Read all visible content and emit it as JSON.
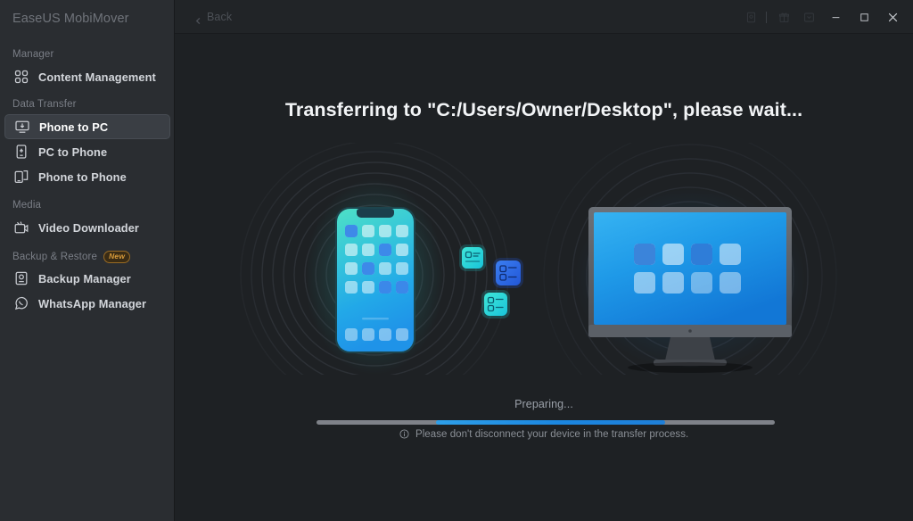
{
  "app": {
    "brand": "EaseUS MobiMover"
  },
  "titlebar": {
    "back_label": "Back",
    "icons": [
      {
        "name": "device-icon",
        "glyph": "device"
      },
      {
        "name": "gift-icon",
        "glyph": "gift"
      },
      {
        "name": "feedback-icon",
        "glyph": "feedback"
      }
    ],
    "minimize_label": "—",
    "maximize_label": "□",
    "close_label": "✕"
  },
  "sidebar": {
    "groups": [
      {
        "label": "Manager",
        "badge": null,
        "items": [
          {
            "label": "Content Management",
            "icon": "grid-apps-icon",
            "active": false
          }
        ]
      },
      {
        "label": "Data Transfer",
        "badge": null,
        "items": [
          {
            "label": "Phone to PC",
            "icon": "phone-to-pc-icon",
            "active": true
          },
          {
            "label": "PC to Phone",
            "icon": "pc-to-phone-icon",
            "active": false
          },
          {
            "label": "Phone to Phone",
            "icon": "phone-to-phone-icon",
            "active": false
          }
        ]
      },
      {
        "label": "Media",
        "badge": null,
        "items": [
          {
            "label": "Video Downloader",
            "icon": "video-download-icon",
            "active": false
          }
        ]
      },
      {
        "label": "Backup & Restore",
        "badge": "New",
        "items": [
          {
            "label": "Backup Manager",
            "icon": "backup-icon",
            "active": false
          },
          {
            "label": "WhatsApp Manager",
            "icon": "whatsapp-icon",
            "active": false
          }
        ]
      }
    ]
  },
  "main": {
    "heading": "Transferring to \"C:/Users/Owner/Desktop\", please wait...",
    "status_text": "Preparing...",
    "footer_note": "Please don't disconnect your device in the transfer process.",
    "progress": {
      "fill_start_percent": 26,
      "fill_width_percent": 50
    },
    "illustration": {
      "source_device": "smartphone",
      "target_device": "desktop-monitor",
      "transfer_cards": 3
    }
  },
  "colors": {
    "sidebar_bg": "#2a2d31",
    "main_bg": "#1e2124",
    "accent_blue": "#1b86e0",
    "accent_cyan": "#2ad6cf",
    "badge_new": "#d79a3a",
    "text_primary": "#f2f4f6",
    "text_muted": "#8b9097"
  }
}
